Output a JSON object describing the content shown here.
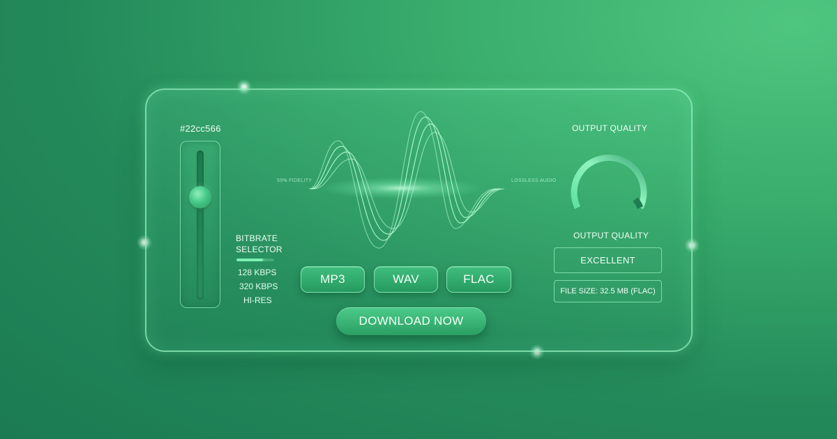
{
  "color_label": "#22cc566",
  "bitrate": {
    "title_line1": "BITBRATE",
    "title_line2": "SELECTOR",
    "level": 0.7,
    "options": [
      "128 KBPS",
      "320 KBPS",
      "HI-RES"
    ]
  },
  "waveform": {
    "left_label": "59% FIDELITY",
    "right_label": "LOSSLESS AUDIO"
  },
  "formats": [
    "MP3",
    "WAV",
    "FLAC"
  ],
  "download_label": "DOWNLOAD NOW",
  "output": {
    "title_top": "OUTPUT QUALITY",
    "title_bottom": "OUTPUT QUALITY",
    "quality_value": "EXCELLENT",
    "file_size": "FILE SIZE: 32.5 MB (FLAC)"
  },
  "colors": {
    "accent": "#22cc66",
    "background": "#2a9a63",
    "glow": "#7df0b4"
  },
  "icons": {
    "gauge": "quality-gauge-icon",
    "waveform": "waveform-icon",
    "slider": "volume-slider"
  }
}
